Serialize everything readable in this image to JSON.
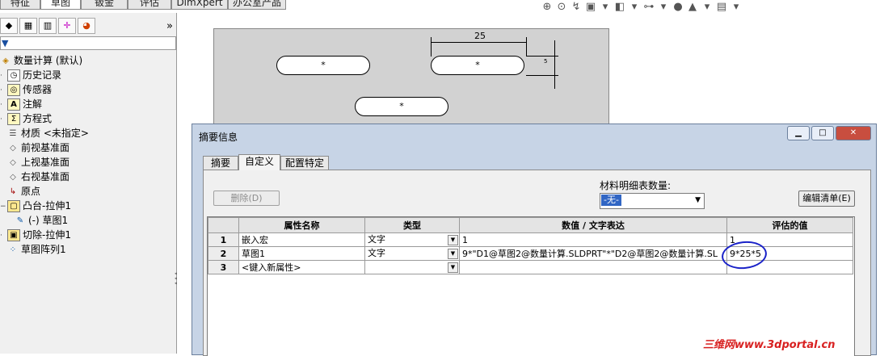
{
  "top_tabs": [
    "特征",
    "草图",
    "钣金",
    "评估",
    "DimXpert",
    "办公室产品"
  ],
  "panel": {
    "more_label": "»",
    "tree": [
      {
        "label": "数量计算  (默认)",
        "icon": "part-icon"
      },
      {
        "label": "历史记录",
        "icon": "history-icon"
      },
      {
        "label": "传感器",
        "icon": "sensor-icon"
      },
      {
        "label": "注解",
        "icon": "annotation-icon"
      },
      {
        "label": "方程式",
        "icon": "equation-icon"
      },
      {
        "label": "材质 <未指定>",
        "icon": "material-icon"
      },
      {
        "label": "前视基准面",
        "icon": "plane-icon"
      },
      {
        "label": "上视基准面",
        "icon": "plane-icon"
      },
      {
        "label": "右视基准面",
        "icon": "plane-icon"
      },
      {
        "label": "原点",
        "icon": "origin-icon"
      },
      {
        "label": "凸台-拉伸1",
        "icon": "boss-extrude-icon"
      },
      {
        "label": "(-) 草图1",
        "icon": "sketch-icon"
      },
      {
        "label": "切除-拉伸1",
        "icon": "cut-extrude-icon"
      },
      {
        "label": "草图阵列1",
        "icon": "sketch-pattern-icon"
      }
    ]
  },
  "drawing": {
    "dim_horizontal": "25",
    "dim_vertical": "5",
    "center_mark": "*"
  },
  "dialog": {
    "title": "摘要信息",
    "tabs": [
      "摘要",
      "自定义",
      "配置特定"
    ],
    "active_tab": "自定义",
    "bom_label": "材料明细表数量:",
    "bom_value": "-无-",
    "delete_label": "删除(D)",
    "edit_list_label": "编辑清单(E)",
    "columns": [
      "属性名称",
      "类型",
      "数值 / 文字表达",
      "评估的值"
    ],
    "rows": [
      {
        "num": "1",
        "name": "嵌入宏",
        "type": "文字",
        "value": "1",
        "evaluated": "1"
      },
      {
        "num": "2",
        "name": "草图1",
        "type": "文字",
        "value": "9*\"D1@草图2@数量计算.SLDPRT\"*\"D2@草图2@数量计算.SL",
        "evaluated": "9*25*5"
      },
      {
        "num": "3",
        "name": "<键入新属性>",
        "type": "",
        "value": "",
        "evaluated": ""
      }
    ]
  },
  "watermark": "三维网www.3dportal.cn",
  "colors": {
    "accent_select": "#3166c4",
    "annotation_circle": "#1a22c8",
    "watermark": "#d82020"
  }
}
